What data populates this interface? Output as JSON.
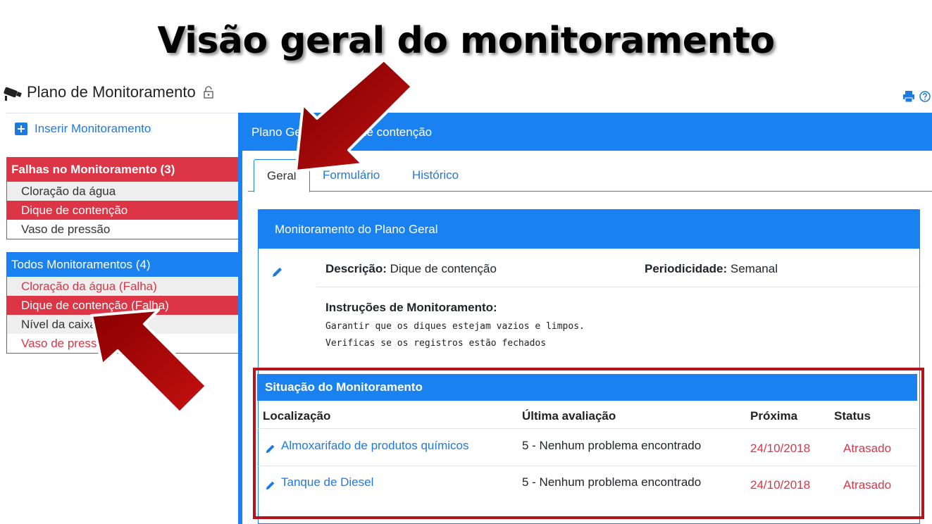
{
  "slide": {
    "title": "Visão geral do monitoramento"
  },
  "header": {
    "title": "Plano de Monitoramento"
  },
  "sidebar": {
    "insert_label": "Inserir Monitoramento",
    "failures": {
      "title": "Falhas no Monitoramento (3)",
      "items": [
        "Cloração da água",
        "Dique de contenção",
        "Vaso de pressão"
      ]
    },
    "all": {
      "title": "Todos Monitoramentos (4)",
      "items": [
        "Cloração da água (Falha)",
        "Dique de contenção (Falha)",
        "Nível da caixa d'água",
        "Vaso de pressão (Falha)"
      ]
    }
  },
  "main": {
    "title": "Plano Geral - Dique de contenção",
    "tabs": [
      "Geral",
      "Formulário",
      "Histórico"
    ],
    "card_title": "Monitoramento do Plano Geral",
    "description_label": "Descrição:",
    "description_value": "Dique de contenção",
    "period_label": "Periodicidade:",
    "period_value": "Semanal",
    "instructions_title": "Instruções de Monitoramento:",
    "instructions": "Garantir que os diques estejam vazios e limpos.\nVerificas se os registros estão fechados"
  },
  "status": {
    "title": "Situação do Monitoramento",
    "columns": [
      "Localização",
      "Última avaliação",
      "Próxima",
      "Status"
    ],
    "rows": [
      {
        "location": "Almoxarifado de produtos químicos",
        "last": "5 - Nenhum problema encontrado",
        "next": "24/10/2018",
        "status": "Atrasado"
      },
      {
        "location": "Tanque de Diesel",
        "last": "5 - Nenhum problema encontrado",
        "next": "24/10/2018",
        "status": "Atrasado"
      }
    ]
  },
  "colors": {
    "primary": "#1a82f0",
    "danger": "#dc3545",
    "arrow": "#a80a0a",
    "highlight_border": "#b4141e"
  },
  "icons": [
    "camera-icon",
    "lock-icon",
    "print-icon",
    "help-icon",
    "plus-icon",
    "pencil-icon"
  ]
}
